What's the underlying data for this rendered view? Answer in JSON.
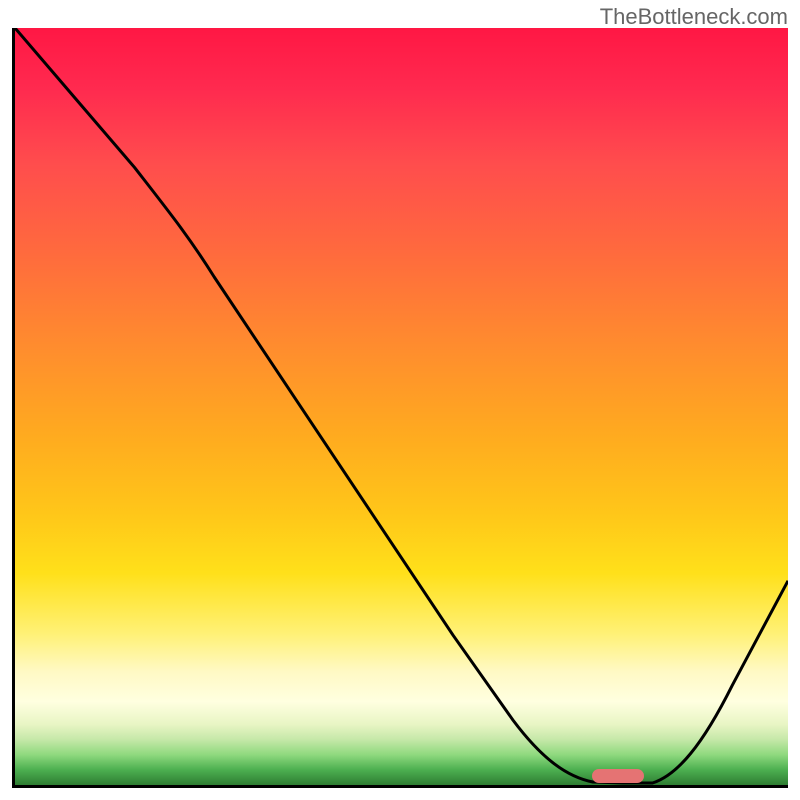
{
  "watermark": "TheBottleneck.com",
  "chart_data": {
    "type": "line",
    "title": "",
    "xlabel": "",
    "ylabel": "",
    "xlim": [
      0,
      100
    ],
    "ylim": [
      0,
      100
    ],
    "x": [
      0,
      5,
      10,
      15,
      20,
      25,
      30,
      35,
      40,
      45,
      50,
      55,
      60,
      65,
      70,
      75,
      78,
      80,
      85,
      90,
      95,
      100
    ],
    "values": [
      100,
      93,
      86,
      79,
      72,
      67,
      60,
      52,
      44,
      36,
      28,
      20,
      13,
      8,
      3,
      1,
      0,
      0,
      1,
      8,
      17,
      27
    ],
    "marker": {
      "x_start": 75,
      "x_end": 82,
      "y": 0
    },
    "gradient_stops": [
      {
        "pos": 0,
        "color": "#ff1744"
      },
      {
        "pos": 50,
        "color": "#ffab1f"
      },
      {
        "pos": 80,
        "color": "#fff176"
      },
      {
        "pos": 100,
        "color": "#2e7d32"
      }
    ]
  }
}
